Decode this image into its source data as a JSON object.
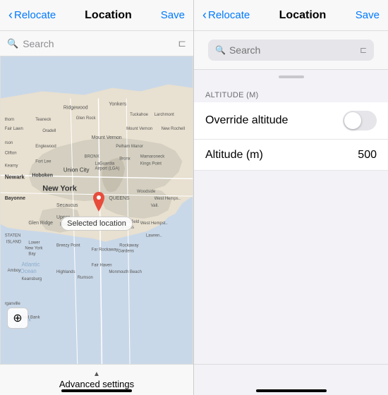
{
  "left": {
    "nav": {
      "back_label": "Relocate",
      "title": "Location",
      "save_label": "Save"
    },
    "search": {
      "placeholder": "Search",
      "bookmark_icon": "bookmark"
    },
    "map": {
      "selected_location_label": "Selected location",
      "pin_alt": "map-pin"
    },
    "bottom": {
      "advanced_settings_label": "Advanced settings",
      "target_icon": "⊕"
    }
  },
  "right": {
    "nav": {
      "back_label": "Relocate",
      "title": "Location",
      "save_label": "Save"
    },
    "search": {
      "placeholder": "Search"
    },
    "altitude": {
      "section_header": "ALTITUDE (M)",
      "override_label": "Override altitude",
      "altitude_label": "Altitude (m)",
      "altitude_value": "500"
    }
  }
}
